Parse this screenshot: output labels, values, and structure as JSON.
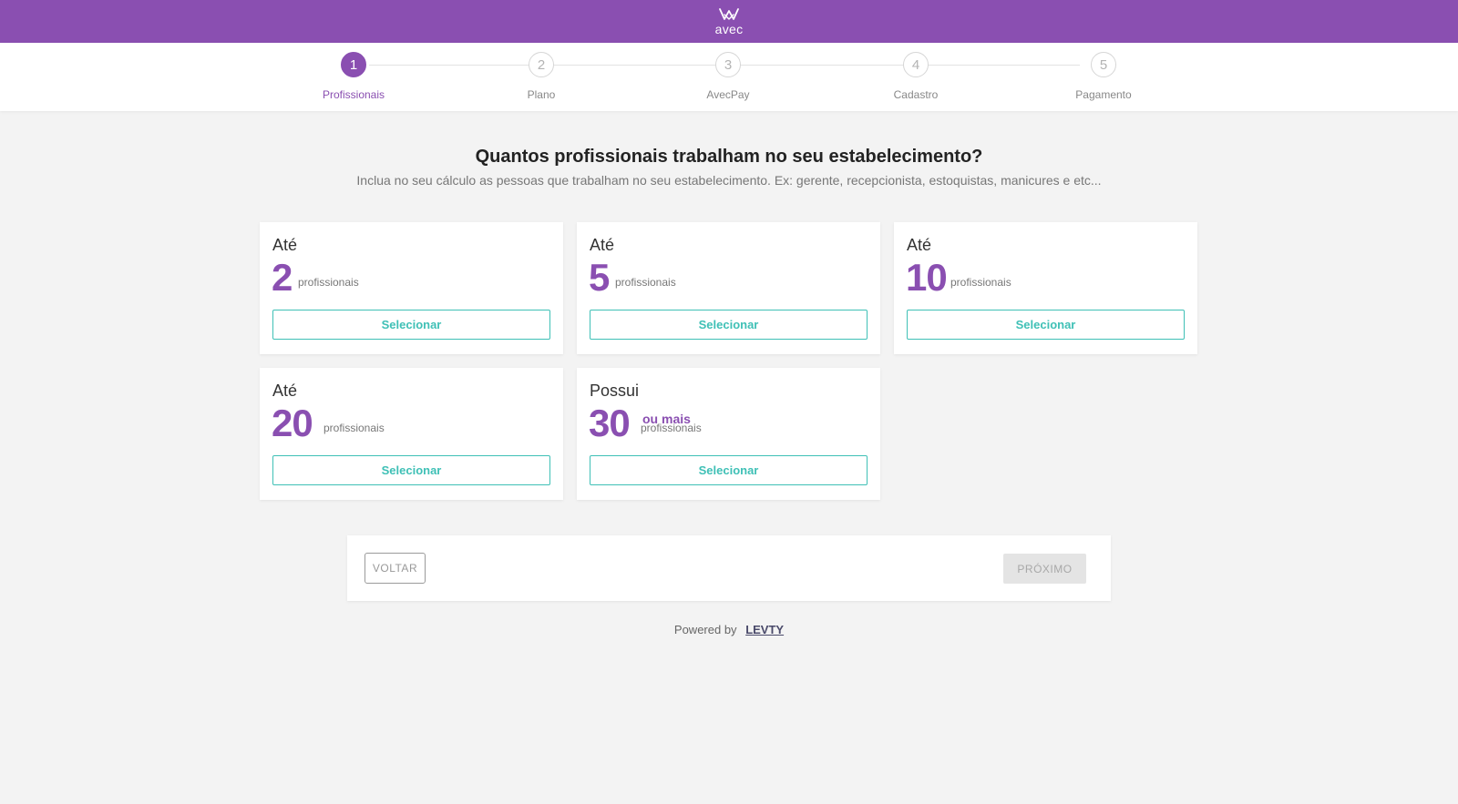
{
  "header": {
    "logo_text": "avec",
    "brand_color": "#8a4fb1"
  },
  "stepper": {
    "active_index": 0,
    "steps": [
      {
        "number": "1",
        "label": "Profissionais"
      },
      {
        "number": "2",
        "label": "Plano"
      },
      {
        "number": "3",
        "label": "AvecPay"
      },
      {
        "number": "4",
        "label": "Cadastro"
      },
      {
        "number": "5",
        "label": "Pagamento"
      }
    ]
  },
  "main": {
    "title": "Quantos profissionais trabalham no seu estabelecimento?",
    "subtitle": "Inclua no seu cálculo as pessoas que trabalham no seu estabelecimento. Ex: gerente, recepcionista, estoquistas, manicures e etc..."
  },
  "options": [
    {
      "prefix": "Até",
      "number": "2",
      "extra": "",
      "unit": "profissionais",
      "button": "Selecionar"
    },
    {
      "prefix": "Até",
      "number": "5",
      "extra": "",
      "unit": "profissionais",
      "button": "Selecionar"
    },
    {
      "prefix": "Até",
      "number": "10",
      "extra": "",
      "unit": "profissionais",
      "button": "Selecionar"
    },
    {
      "prefix": "Até",
      "number": "20",
      "extra": "",
      "unit": "profissionais",
      "button": "Selecionar"
    },
    {
      "prefix": "Possui",
      "number": "30",
      "extra": "ou mais",
      "unit": "profissionais",
      "button": "Selecionar"
    }
  ],
  "navigation": {
    "back_label": "VOLTAR",
    "next_label": "PRÓXIMO",
    "next_disabled": true
  },
  "footer": {
    "powered_by": "Powered by",
    "brand_link": "LEVTY"
  },
  "colors": {
    "accent": "#3fc0b6",
    "background": "#f3f3f3"
  }
}
